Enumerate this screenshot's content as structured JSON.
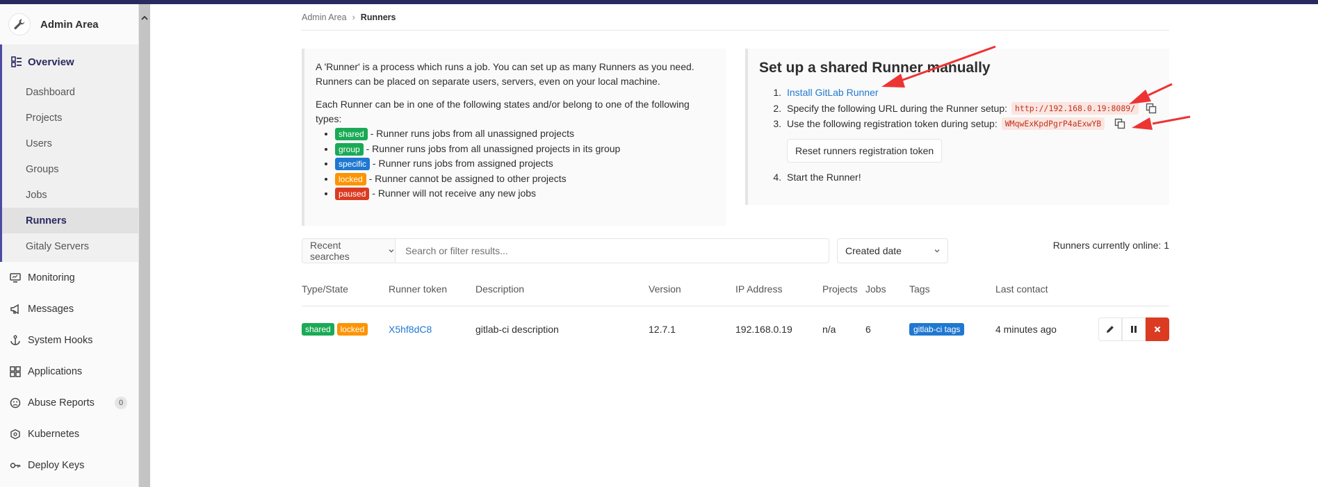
{
  "sidebar": {
    "title": "Admin Area",
    "overview_label": "Overview",
    "sub_items": [
      {
        "label": "Dashboard"
      },
      {
        "label": "Projects"
      },
      {
        "label": "Users"
      },
      {
        "label": "Groups"
      },
      {
        "label": "Jobs"
      },
      {
        "label": "Runners",
        "active": true
      },
      {
        "label": "Gitaly Servers"
      }
    ],
    "items": [
      {
        "label": "Monitoring",
        "icon": "monitor-icon"
      },
      {
        "label": "Messages",
        "icon": "megaphone-icon"
      },
      {
        "label": "System Hooks",
        "icon": "anchor-icon"
      },
      {
        "label": "Applications",
        "icon": "grid-icon"
      },
      {
        "label": "Abuse Reports",
        "icon": "flag-face-icon",
        "count": "0"
      },
      {
        "label": "Kubernetes",
        "icon": "cloud-icon"
      },
      {
        "label": "Deploy Keys",
        "icon": "key-icon"
      }
    ]
  },
  "breadcrumb": {
    "parent": "Admin Area",
    "current": "Runners"
  },
  "intro": {
    "p1": "A 'Runner' is a process which runs a job. You can set up as many Runners as you need. Runners can be placed on separate users, servers, even on your local machine.",
    "p2": "Each Runner can be in one of the following states and/or belong to one of the following types:",
    "states": [
      {
        "badge": "shared",
        "text": "- Runner runs jobs from all unassigned projects"
      },
      {
        "badge": "group",
        "text": "- Runner runs jobs from all unassigned projects in its group"
      },
      {
        "badge": "specific",
        "text": "- Runner runs jobs from assigned projects"
      },
      {
        "badge": "locked",
        "text": "- Runner cannot be assigned to other projects"
      },
      {
        "badge": "paused",
        "text": "- Runner will not receive any new jobs"
      }
    ]
  },
  "setup": {
    "title": "Set up a shared Runner manually",
    "step1_link": "Install GitLab Runner",
    "step2_text": "Specify the following URL during the Runner setup:",
    "step2_url": "http://192.168.0.19:8089/",
    "step3_text": "Use the following registration token during setup:",
    "step3_token": "WMqwExKpdPgrP4aExwYB",
    "reset_label": "Reset runners registration token",
    "step4_text": "Start the Runner!"
  },
  "filter": {
    "recent_label": "Recent searches",
    "search_placeholder": "Search or filter results...",
    "sort_label": "Created date",
    "online_text": "Runners currently online: 1"
  },
  "table": {
    "headers": [
      "Type/State",
      "Runner token",
      "Description",
      "Version",
      "IP Address",
      "Projects",
      "Jobs",
      "Tags",
      "Last contact"
    ],
    "rows": [
      {
        "badges": [
          "shared",
          "locked"
        ],
        "token": "X5hf8dC8",
        "description": "gitlab-ci description",
        "version": "12.7.1",
        "ip": "192.168.0.19",
        "projects": "n/a",
        "jobs": "6",
        "tag": "gitlab-ci tags",
        "last_contact": "4 minutes ago"
      }
    ]
  },
  "colors": {
    "nav_accent": "#292961",
    "shared": "#1aaa55",
    "specific": "#1f78d1",
    "locked": "#fc9403",
    "paused": "#db3b21",
    "annotation_arrow": "#ee3333"
  }
}
